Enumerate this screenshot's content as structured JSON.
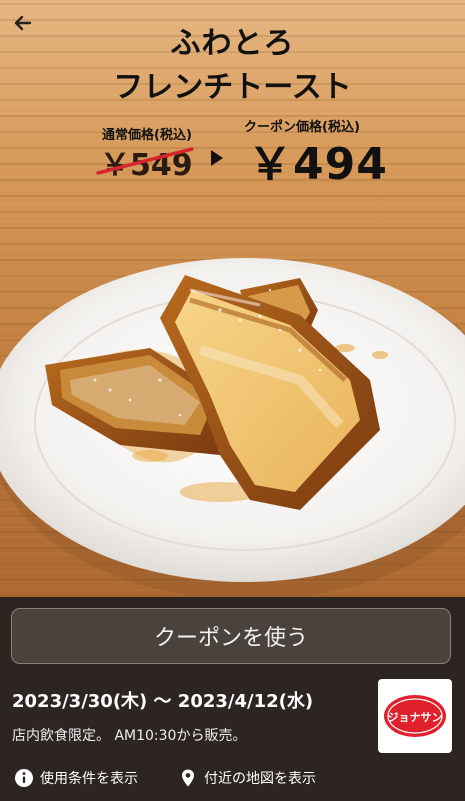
{
  "header": {
    "back_icon": "arrow-left-icon"
  },
  "product": {
    "title_line1": "ふわとろ",
    "title_line2": "フレンチトースト"
  },
  "pricing": {
    "normal_label": "通常価格(税込)",
    "normal_price": "￥549",
    "coupon_label": "クーポン価格(税込)",
    "coupon_price": "￥494"
  },
  "actions": {
    "use_coupon": "クーポンを使う"
  },
  "coupon_info": {
    "date_range": "2023/3/30(木) 〜 2023/4/12(水)",
    "note": "店内飲食限定。 AM10:30から販売。",
    "brand_logo_text": "ジョナサン"
  },
  "links": {
    "conditions": "使用条件を表示",
    "nearby_map": "付近の地図を表示"
  },
  "colors": {
    "strike_red": "#d6262d",
    "panel_bg": "#2c2521",
    "button_bg": "#4a423d"
  }
}
